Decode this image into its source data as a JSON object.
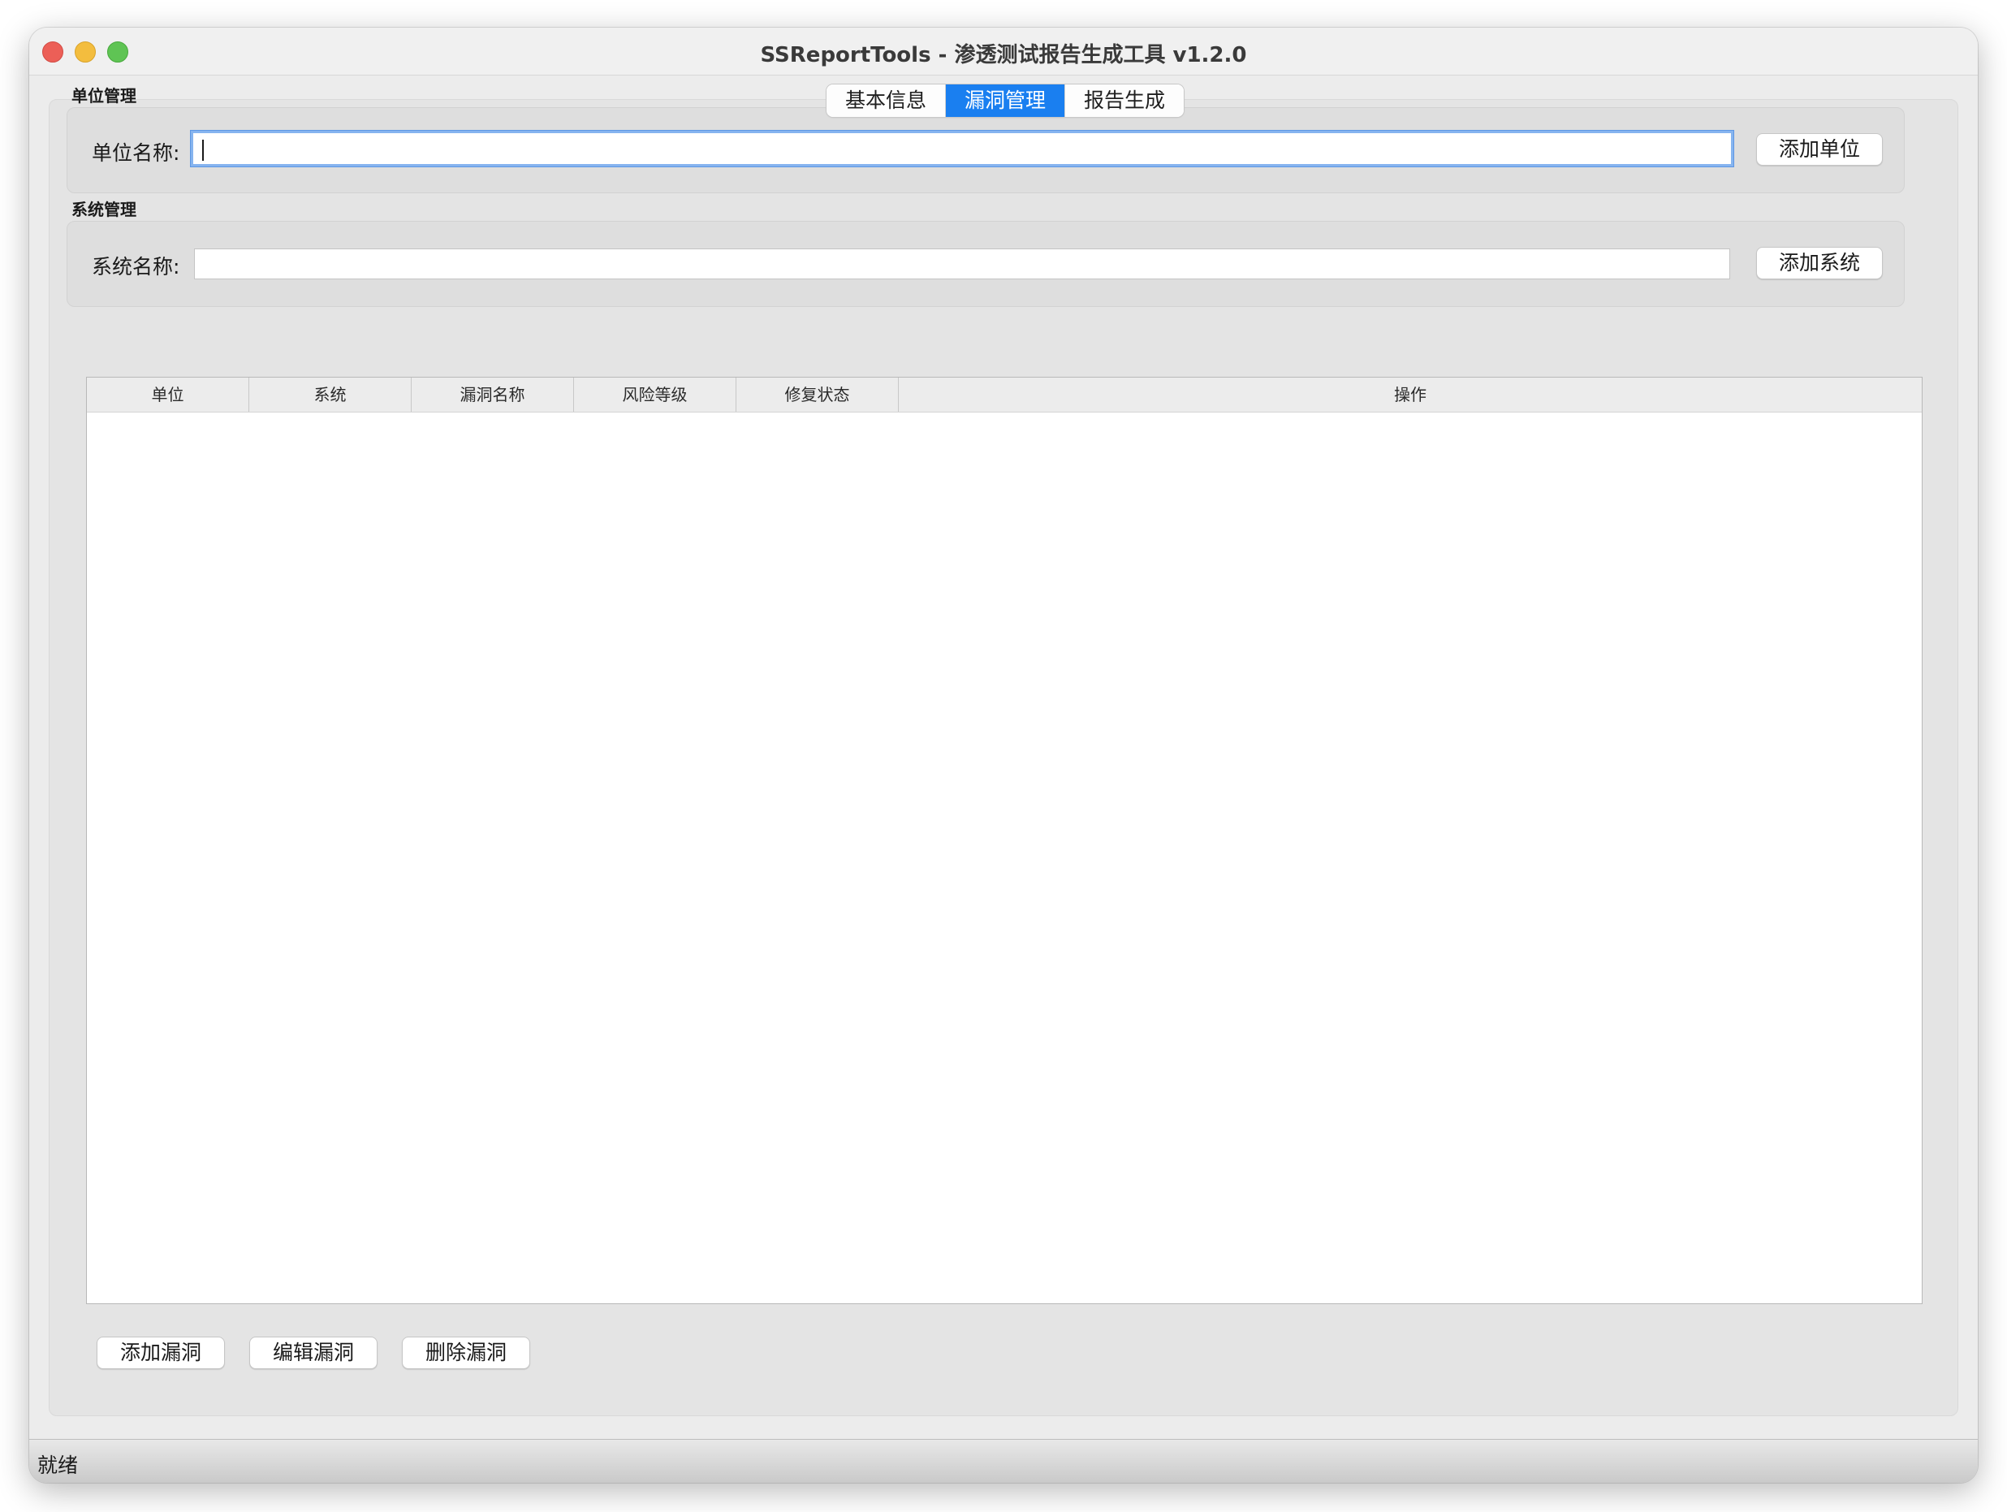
{
  "window": {
    "title": "SSReportTools - 渗透测试报告生成工具 v1.2.0"
  },
  "tabs": [
    {
      "label": "基本信息",
      "active": false
    },
    {
      "label": "漏洞管理",
      "active": true
    },
    {
      "label": "报告生成",
      "active": false
    }
  ],
  "unit_section": {
    "title": "单位管理",
    "field_label": "单位名称:",
    "input_value": "",
    "add_button": "添加单位"
  },
  "system_section": {
    "title": "系统管理",
    "field_label": "系统名称:",
    "input_value": "",
    "add_button": "添加系统"
  },
  "table": {
    "columns": [
      "单位",
      "系统",
      "漏洞名称",
      "风险等级",
      "修复状态",
      "操作"
    ],
    "rows": []
  },
  "actions": {
    "add": "添加漏洞",
    "edit": "编辑漏洞",
    "delete": "删除漏洞"
  },
  "status": {
    "text": "就绪"
  },
  "colors": {
    "accent": "#1a7ff0",
    "focus_ring": "#86b4ef",
    "close": "#ec5f57",
    "minimize": "#f3bd3e",
    "maximize": "#5fc454"
  }
}
